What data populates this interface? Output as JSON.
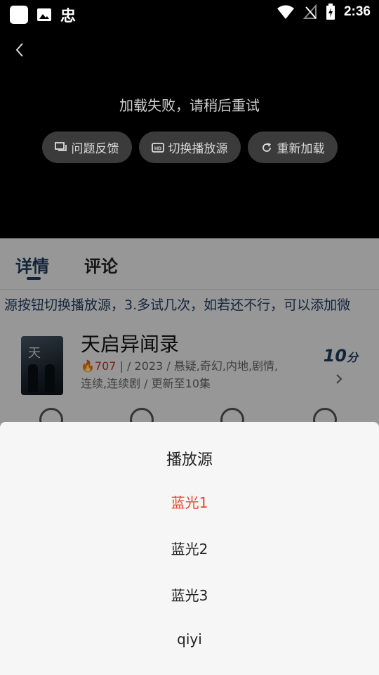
{
  "status_bar": {
    "time": "2:36"
  },
  "player": {
    "error_message": "加载失败，请稍后重试",
    "actions": [
      {
        "label": "问题反馈",
        "icon": "feedback-icon"
      },
      {
        "label": "切换播放源",
        "icon": "hd-source-icon"
      },
      {
        "label": "重新加载",
        "icon": "reload-icon"
      }
    ]
  },
  "tabs": [
    {
      "label": "详情",
      "active": true
    },
    {
      "label": "评论",
      "active": false
    }
  ],
  "marquee_text": "源按钮切换播放源，3.多试几次，如若还不行，可以添加微",
  "movie": {
    "title": "天启异闻录",
    "heat": "707",
    "meta_line1": "|   / 2023 / 悬疑,奇幻,内地,剧情,",
    "meta_line2": "连续,连续剧 / 更新至10集",
    "score_number": "10",
    "score_unit": "分"
  },
  "source_sheet": {
    "title": "播放源",
    "options": [
      {
        "label": "蓝光1",
        "selected": true
      },
      {
        "label": "蓝光2",
        "selected": false
      },
      {
        "label": "蓝光3",
        "selected": false
      },
      {
        "label": "qiyi",
        "selected": false
      }
    ],
    "selected_color": "#e5472f"
  }
}
